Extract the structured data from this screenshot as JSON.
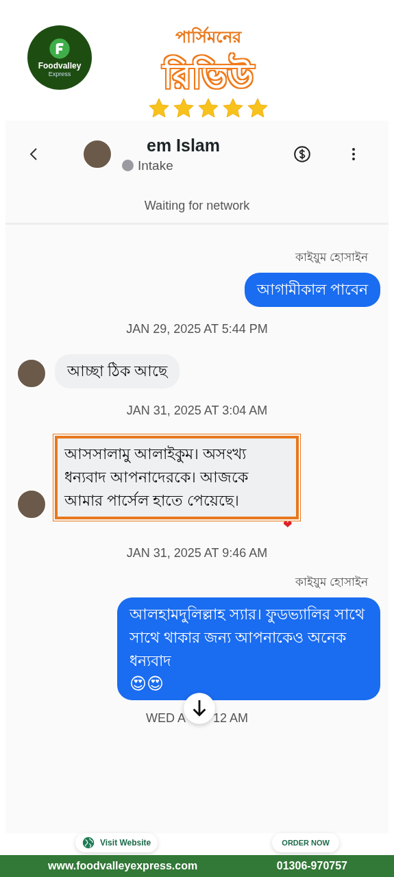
{
  "promo": {
    "logo": {
      "name": "Foodvalley",
      "tagline": "Express"
    },
    "kicker": "পার্সিমনের",
    "headline": "রিভিউ",
    "stars": 5
  },
  "chat_header": {
    "name": "em Islam",
    "status": "Intake",
    "banner": "Waiting for network"
  },
  "messages": [
    {
      "kind": "sender",
      "text": "কাইয়ুম হোসাইন"
    },
    {
      "kind": "outgoing",
      "text": "আগামীকাল পাবেন",
      "highlighted": false
    },
    {
      "kind": "timestamp",
      "text": "JAN 29, 2025 AT 5:44 PM"
    },
    {
      "kind": "incoming",
      "text": "আচ্ছা ঠিক আছে",
      "highlighted": false
    },
    {
      "kind": "timestamp",
      "text": "JAN 31, 2025 AT 3:04 AM"
    },
    {
      "kind": "incoming",
      "text": "আসসালামু আলাইকুম। অসংখ্য ধন্যবাদ আপনাদেরকে। আজকে আমার পার্সেল হাতে পেয়েছে।",
      "highlighted": true,
      "reaction": "❤"
    },
    {
      "kind": "timestamp",
      "text": "JAN 31, 2025 AT 9:46 AM"
    },
    {
      "kind": "sender",
      "text": "কাইয়ুম হোসাইন"
    },
    {
      "kind": "outgoing",
      "text": "আলহামদুলিল্লাহ স্যার। ফুডভ্যালির সাথে সাথে থাকার জন্য আপনাকেও অনেক ধন্যবাদ",
      "highlighted": false,
      "emojis": "😍😍"
    }
  ],
  "last_timestamp": [
    "WED A",
    "12 AM"
  ],
  "footer": {
    "visit_button": "Visit Website",
    "order_button": "ORDER NOW",
    "website": "www.foodvalleyexpress.com",
    "phone": "01306-970757"
  }
}
